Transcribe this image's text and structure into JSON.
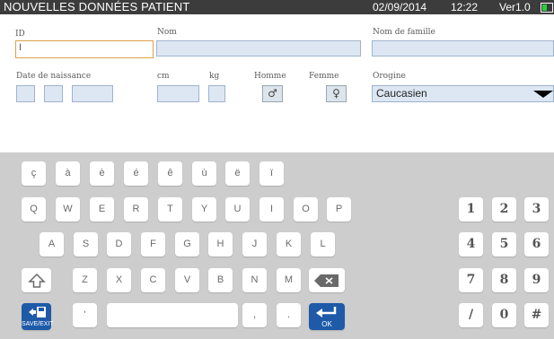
{
  "header": {
    "title": "NOUVELLES DONNÉES PATIENT",
    "date": "02/09/2014",
    "time": "12:22",
    "version": "Ver1.0",
    "battery_color": "#28d23c"
  },
  "form": {
    "id_label": "ID",
    "id_value": "I",
    "nom_label": "Nom",
    "famille_label": "Nom de famille",
    "dob_label": "Date de naissance",
    "cm_label": "cm",
    "kg_label": "kg",
    "homme_label": "Homme",
    "femme_label": "Femme",
    "homme_icon": "♂",
    "femme_icon": "♀",
    "origin_label": "Orogine",
    "origin_value": "Caucasien"
  },
  "keyboard": {
    "row_accents": [
      "ç",
      "à",
      "è",
      "é",
      "ê",
      "ù",
      "ë",
      "ï"
    ],
    "row1": [
      "Q",
      "W",
      "E",
      "R",
      "T",
      "Y",
      "U",
      "I",
      "O",
      "P"
    ],
    "row2": [
      "A",
      "S",
      "D",
      "F",
      "G",
      "H",
      "J",
      "K",
      "L"
    ],
    "row3": [
      "Z",
      "X",
      "C",
      "V",
      "B",
      "N",
      "M"
    ],
    "numpad": [
      "1",
      "2",
      "3",
      "4",
      "5",
      "6",
      "7",
      "8",
      "9",
      "/",
      "0",
      "#"
    ],
    "apostrophe": "'",
    "comma": ",",
    "period": ".",
    "save_exit_label": "SAVE/EXIT",
    "ok_label": "OK"
  }
}
